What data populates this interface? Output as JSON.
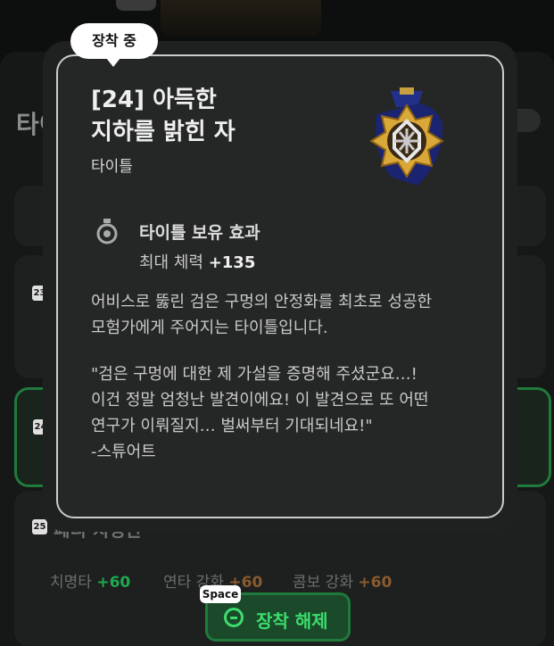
{
  "background": {
    "section_title": "타이",
    "cards": [
      {
        "level": "23",
        "title": ""
      },
      {
        "level": "24",
        "title": ""
      },
      {
        "level": "25",
        "title": "페티 치명관"
      }
    ],
    "stats": [
      {
        "label": "치명타",
        "value": "+60"
      },
      {
        "label": "연타 강화",
        "value": "+60"
      },
      {
        "label": "콤보 강화",
        "value": "+60"
      }
    ]
  },
  "tooltip": {
    "equipped_badge": "장착 중",
    "title_name": "[24] 아득한\n지하를 밝힌 자",
    "title_type": "타이틀",
    "medal_icon": "medal-icon",
    "effect": {
      "heading": "타이틀 보유 효과",
      "stat_label": "최대 체력",
      "stat_value": "+135"
    },
    "description": "어비스로 뚫린 검은 구멍의 안정화를 최초로 성공한\n모험가에게 주어지는 타이틀입니다.",
    "quote": "\"검은 구멍에 대한 제 가설을 증명해 주셨군요…!\n이건 정말 엄청난 발견이에요! 이 발견으로 또 어떤\n연구가 이뤄질지… 벌써부터 기대되네요!\"\n-스튜어트"
  },
  "actions": {
    "unequip_label": "장착 해제",
    "key_hint": "Space"
  },
  "colors": {
    "accent_green": "#3ddc6e",
    "tooltip_bg": "#252726"
  }
}
